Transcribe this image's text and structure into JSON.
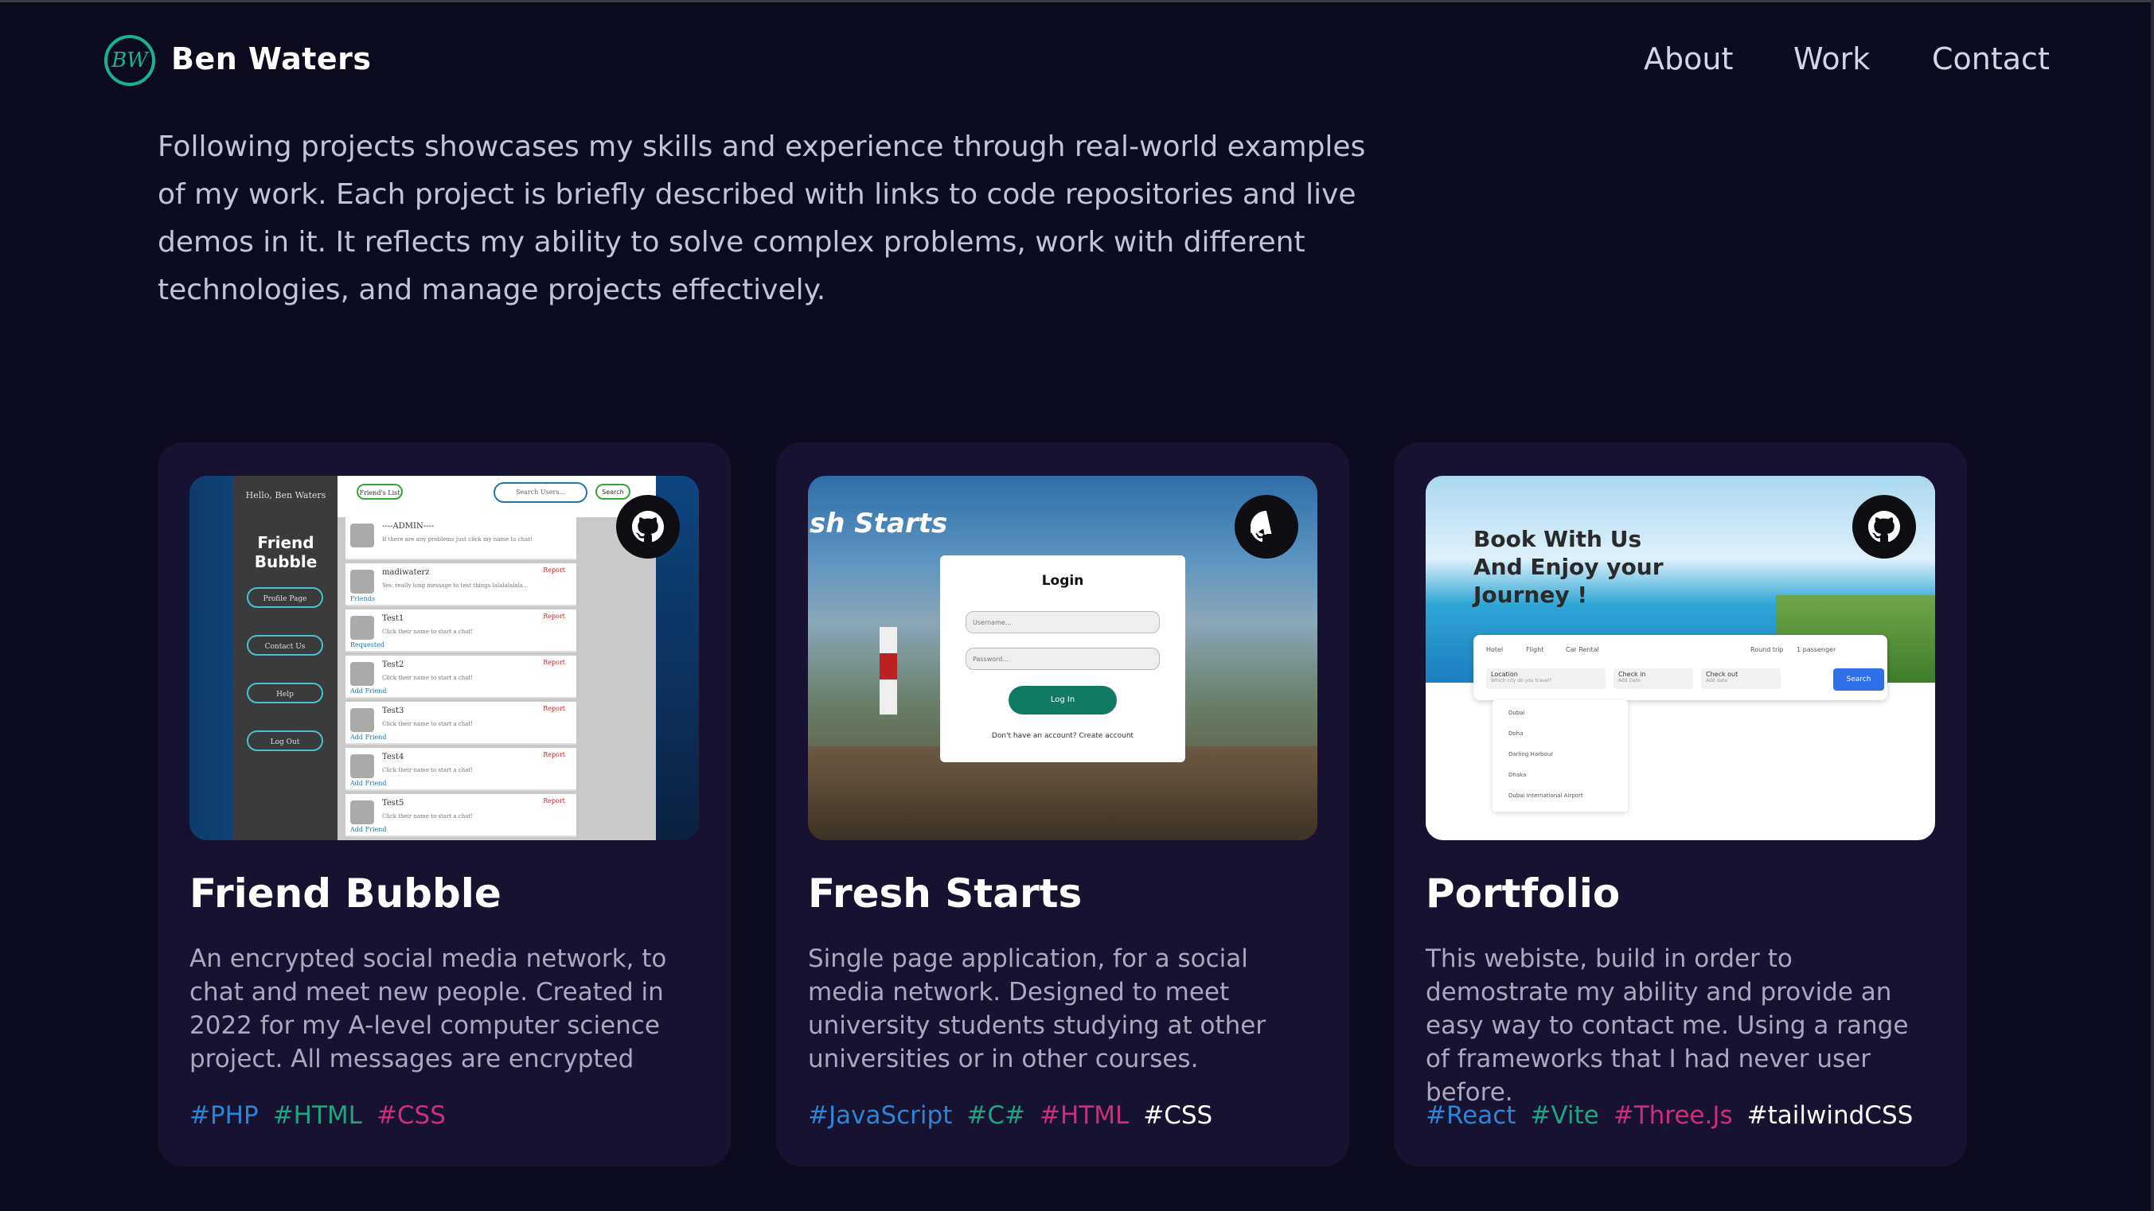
{
  "header": {
    "logo_text": "BW",
    "brand": "Ben Waters",
    "nav": [
      "About",
      "Work",
      "Contact"
    ]
  },
  "intro": "Following projects showcases my skills and experience through real-world examples of my work. Each project is briefly described with links to code repositories and live demos in it. It reflects my ability to solve complex problems, work with different technologies, and manage projects effectively.",
  "projects": [
    {
      "title": "Friend Bubble",
      "description": "An encrypted social media network, to chat and meet new people. Created in 2022 for my A-level computer science project. All messages are encrypted",
      "tags": [
        "#PHP",
        "#HTML",
        "#CSS"
      ],
      "preview": {
        "greeting": "Hello, Ben Waters",
        "app_title": "Friend Bubble",
        "menu": [
          "Profile Page",
          "Contact Us",
          "Help",
          "Log Out"
        ],
        "friends_button": "Friend's List",
        "search_placeholder": "Search Users...",
        "search_button": "Search",
        "rows": [
          {
            "name": "----ADMIN----",
            "text": "If there are any problems just click my name to chat!",
            "link": ""
          },
          {
            "name": "madiwaterz",
            "text": "Yes: really long message to test things lalalalalala...",
            "link": "Friends"
          },
          {
            "name": "Test1",
            "text": "Click their name to start a chat!",
            "link": "Requested"
          },
          {
            "name": "Test2",
            "text": "Click their name to start a chat!",
            "link": "Add Friend"
          },
          {
            "name": "Test3",
            "text": "Click their name to start a chat!",
            "link": "Add Friend"
          },
          {
            "name": "Test4",
            "text": "Click their name to start a chat!",
            "link": "Add Friend"
          },
          {
            "name": "Test5",
            "text": "Click their name to start a chat!",
            "link": "Add Friend"
          }
        ],
        "report": "Report"
      }
    },
    {
      "title": "Fresh Starts",
      "description": "Single page application, for a social media network. Designed to meet university students studying at other universities or in other courses.",
      "tags": [
        "#JavaScript",
        "#C#",
        "#HTML",
        "#CSS"
      ],
      "preview": {
        "banner": "sh Starts",
        "login_title": "Login",
        "username_placeholder": "Username...",
        "password_placeholder": "Password...",
        "login_button": "Log In",
        "create_account": "Don't have an account? Create account"
      }
    },
    {
      "title": "Portfolio",
      "description": "This webiste, build in order to demostrate my ability and provide an easy way to contact me. Using a range of frameworks that I had never user before.",
      "tags": [
        "#React",
        "#Vite",
        "#Three.Js",
        "#tailwindCSS"
      ],
      "preview": {
        "headline": [
          "Book With Us",
          "And Enjoy your",
          "Journey !"
        ],
        "tabs": [
          "Hotel",
          "Flight",
          "Car Rental"
        ],
        "trip": "Round trip",
        "passengers": "1 passenger",
        "location_label": "Location",
        "location_hint": "Which city do you travel?",
        "checkin_label": "Check in",
        "checkin_hint": "Add Date",
        "checkout_label": "Check out",
        "checkout_hint": "Add date",
        "search_button": "Search",
        "suggestions": [
          "Dubai",
          "Doha",
          "Darling Harbour",
          "Dhaka",
          "Dubai International Airport"
        ]
      }
    }
  ],
  "colors": {
    "background": "#0c0b1e",
    "card": "#161230",
    "accent": "#17b294",
    "tag_blue": "#2c84d7",
    "tag_green": "#1fa57e",
    "tag_pink": "#cf2d79"
  }
}
